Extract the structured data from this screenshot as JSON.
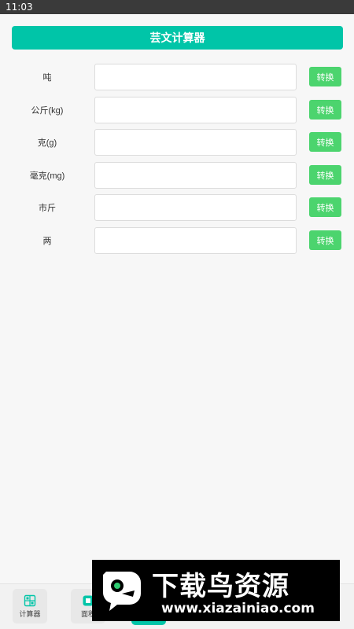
{
  "status_bar": {
    "time": "11:03"
  },
  "header": {
    "title": "芸文计算器"
  },
  "converter": {
    "rows": [
      {
        "label": "吨",
        "value": "",
        "button": "转换"
      },
      {
        "label": "公斤(kg)",
        "value": "",
        "button": "转换"
      },
      {
        "label": "克(g)",
        "value": "",
        "button": "转换"
      },
      {
        "label": "毫克(mg)",
        "value": "",
        "button": "转换"
      },
      {
        "label": "市斤",
        "value": "",
        "button": "转换"
      },
      {
        "label": "两",
        "value": "",
        "button": "转换"
      }
    ]
  },
  "bottom_nav": {
    "items": [
      {
        "label": "计算器",
        "icon": "calculator-icon"
      },
      {
        "label": "面积",
        "icon": "area-icon"
      }
    ]
  },
  "watermark": {
    "title": "下载鸟资源",
    "url": "www.xiazainiao.com",
    "logo": "bird-logo"
  },
  "colors": {
    "accent": "#00c5a8",
    "button": "#4cd46e",
    "status_bar": "#3a3a3a"
  }
}
